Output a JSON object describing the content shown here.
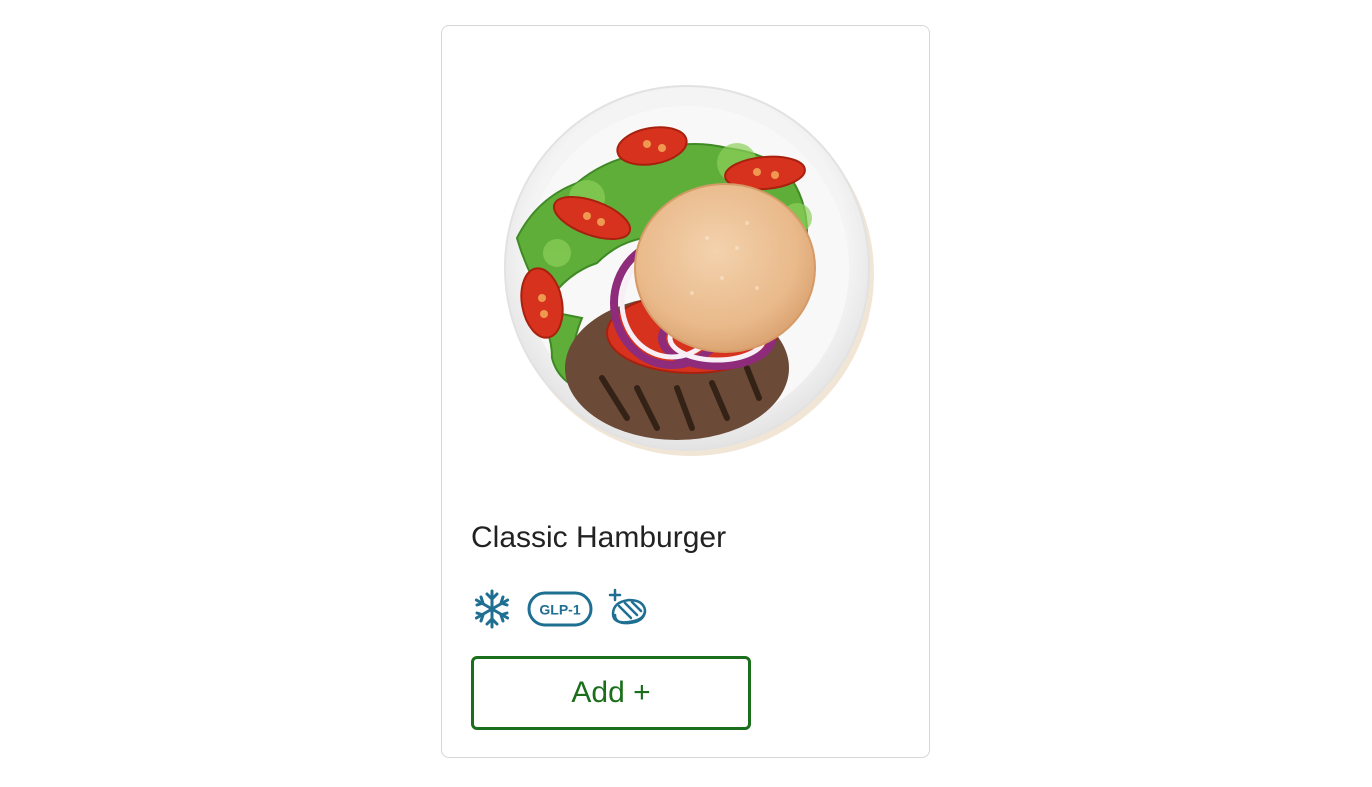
{
  "product": {
    "title": "Classic Hamburger",
    "image_subject": "hamburger-on-plate-with-salad",
    "badges": [
      {
        "name": "frozen",
        "icon": "snowflake-icon",
        "label": ""
      },
      {
        "name": "glp-1",
        "icon": "glp1-badge-icon",
        "label": "GLP-1"
      },
      {
        "name": "protein",
        "icon": "protein-plus-icon",
        "label": ""
      }
    ],
    "add_button_label": "Add +"
  },
  "colors": {
    "badge": "#1f6f93",
    "button": "#1b6e1b",
    "title": "#222222",
    "card_border": "#d6d6d6"
  }
}
